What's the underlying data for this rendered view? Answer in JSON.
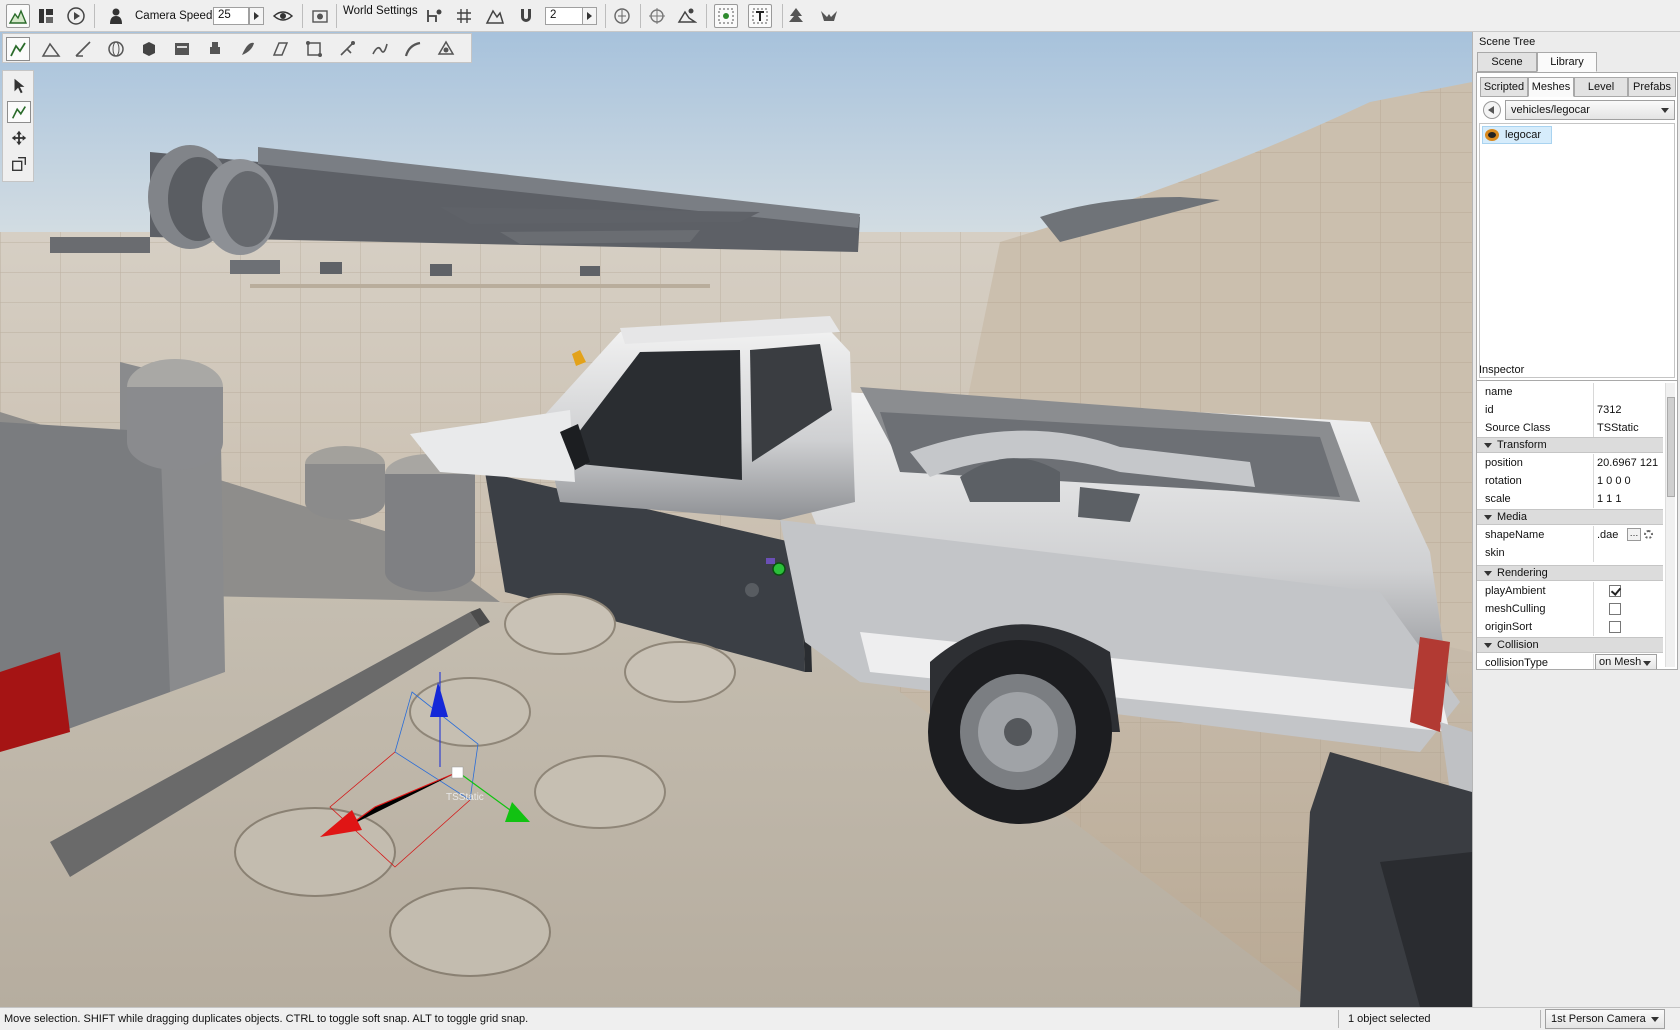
{
  "toolbar": {
    "camera_speed_label": "Camera Speed",
    "camera_speed_value": "25",
    "world_settings_label": "World Settings",
    "snap_value": "2"
  },
  "viewport": {
    "gizmo_label": "TSStatic"
  },
  "scene_tree": {
    "title": "Scene Tree",
    "tabs": [
      "Scene",
      "Library"
    ],
    "active_tab": "Library",
    "sub_tabs": [
      "Scripted",
      "Meshes",
      "Level",
      "Prefabs"
    ],
    "active_sub_tab": "Meshes",
    "path": "vehicles/legocar",
    "items": [
      {
        "label": "legocar"
      }
    ]
  },
  "inspector": {
    "title": "Inspector",
    "general": [
      {
        "key": "name",
        "value": ""
      },
      {
        "key": "id",
        "value": "7312"
      },
      {
        "key": "Source Class",
        "value": "TSStatic"
      }
    ],
    "transform_group": "Transform",
    "transform": [
      {
        "key": "position",
        "value": "20.6967 121"
      },
      {
        "key": "rotation",
        "value": "1 0 0 0"
      },
      {
        "key": "scale",
        "value": "1 1 1"
      }
    ],
    "media_group": "Media",
    "media": [
      {
        "key": "shapeName",
        "value": ".dae"
      },
      {
        "key": "skin",
        "value": ""
      }
    ],
    "rendering_group": "Rendering",
    "rendering": [
      {
        "key": "playAmbient",
        "checked": true
      },
      {
        "key": "meshCulling",
        "checked": false
      },
      {
        "key": "originSort",
        "checked": false
      }
    ],
    "collision_group": "Collision",
    "collision": [
      {
        "key": "collisionType",
        "value": "on Mesh"
      }
    ]
  },
  "statusbar": {
    "hint": "Move selection.  SHIFT while dragging duplicates objects.  CTRL to toggle soft snap.  ALT to toggle grid snap.",
    "selection": "1 object selected",
    "camera_mode": "1st Person Camera"
  },
  "colors": {
    "sky_top": "#a9c4dc",
    "ground": "#c7b6a2",
    "gizmo_x": "#e01515",
    "gizmo_y": "#12c212",
    "gizmo_z": "#1428d8",
    "selection_bg": "#d6ecfb"
  }
}
